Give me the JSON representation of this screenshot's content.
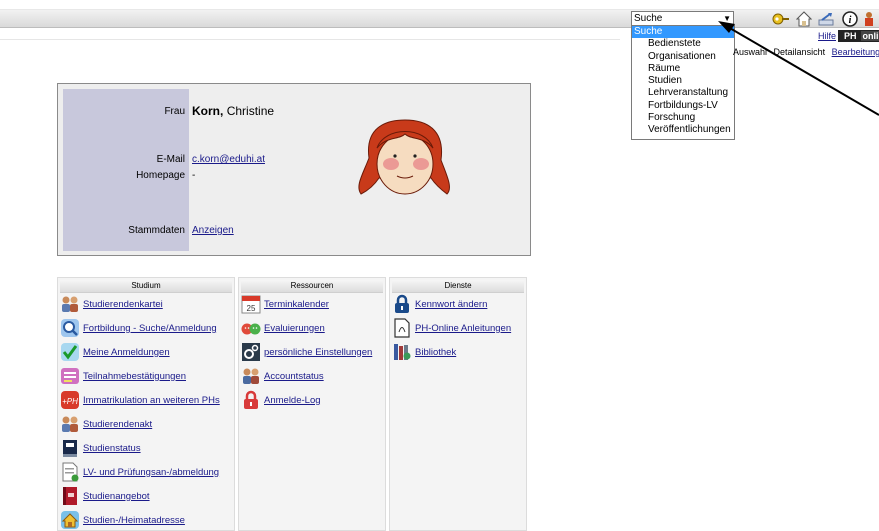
{
  "search": {
    "selected": "Suche",
    "options": [
      "Suche",
      "Bedienstete",
      "Organisationen",
      "Räume",
      "Studien",
      "Lehrveranstaltung",
      "Fortbildungs-LV",
      "Forschung",
      "Veröffentlichungen"
    ]
  },
  "header": {
    "hilfe": "Hilfe",
    "ph": "PH",
    "online": "onli",
    "links": [
      "Auswahl",
      "Detailansicht",
      "Bearbeitung"
    ]
  },
  "person": {
    "salutation": "Frau",
    "last_name": "Korn,",
    "first_name": "Christine",
    "email_label": "E-Mail",
    "email": "c.korn@eduhi.at",
    "homepage_label": "Homepage",
    "homepage": "-",
    "stammdaten_label": "Stammdaten",
    "stammdaten_link": "Anzeigen"
  },
  "sections": {
    "studium": {
      "title": "Studium",
      "items": [
        {
          "label": "Studierendenkartei",
          "icon": "students-icon"
        },
        {
          "label": "Fortbildung - Suche/Anmeldung",
          "icon": "magnifier-icon"
        },
        {
          "label": "Meine Anmeldungen",
          "icon": "checkmark-icon"
        },
        {
          "label": "Teilnahmebestätigungen",
          "icon": "certificate-icon"
        },
        {
          "label": "Immatrikulation an weiteren PHs",
          "icon": "plus-ph-icon"
        },
        {
          "label": "Studierendenakt",
          "icon": "students-icon"
        },
        {
          "label": "Studienstatus",
          "icon": "status-icon"
        },
        {
          "label": "LV- und Prüfungsan-/abmeldung",
          "icon": "document-icon"
        },
        {
          "label": "Studienangebot",
          "icon": "book-icon"
        },
        {
          "label": "Studien-/Heimatadresse",
          "icon": "house-icon"
        }
      ]
    },
    "ressourcen": {
      "title": "Ressourcen",
      "items": [
        {
          "label": "Terminkalender",
          "icon": "calendar-icon",
          "badge": "25"
        },
        {
          "label": "Evaluierungen",
          "icon": "faces-icon"
        },
        {
          "label": "persönliche Einstellungen",
          "icon": "gears-icon"
        },
        {
          "label": "Accountstatus",
          "icon": "users-icon"
        },
        {
          "label": "Anmelde-Log",
          "icon": "lock-icon"
        }
      ]
    },
    "dienste": {
      "title": "Dienste",
      "items": [
        {
          "label": "Kennwort ändern",
          "icon": "padlock-icon"
        },
        {
          "label": "PH-Online Anleitungen",
          "icon": "pdf-icon"
        },
        {
          "label": "Bibliothek",
          "icon": "library-icon"
        }
      ]
    }
  },
  "colors": {
    "link": "#1a1a8a",
    "dropdown_selected": "#3399ff",
    "card_side": "#c8c8dc",
    "card_bg": "#eeeeee"
  }
}
